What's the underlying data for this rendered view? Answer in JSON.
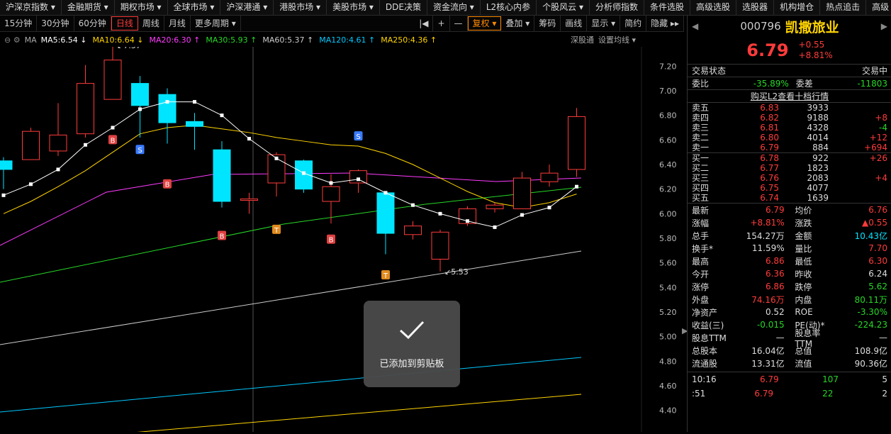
{
  "nav": [
    "沪深京指数 ▾",
    "金融期货 ▾",
    "期权市场 ▾",
    "全球市场 ▾",
    "沪深港通 ▾",
    "港股市场 ▾",
    "美股市场 ▾",
    "DDE决策",
    "资金流向 ▾",
    "L2核心内参",
    "个股风云 ▾",
    "分析师指数",
    "条件选股",
    "高级选股",
    "选股器",
    "机构增仓",
    "热点追击",
    "高级"
  ],
  "toolbar": {
    "periods": [
      "15分钟",
      "30分钟",
      "60分钟"
    ],
    "daily": "日线",
    "weekly": "周线",
    "monthly": "月线",
    "more": "更多周期 ▾",
    "prev": "|◀",
    "plus": "+",
    "minus": "—",
    "fuquan": "复权 ▾",
    "overlay": "叠加 ▾",
    "chouma": "筹码",
    "draw": "画线",
    "display": "显示 ▾",
    "simple": "简约",
    "hide": "隐藏 ▸▸",
    "collapse": "◀"
  },
  "ma": {
    "label": "MA",
    "items": [
      {
        "text": "MA5:6.54 ↓",
        "color": "#ffffff"
      },
      {
        "text": "MA10:6.64 ↓",
        "color": "#ffd400"
      },
      {
        "text": "MA20:6.30 ↑",
        "color": "#ff3bff"
      },
      {
        "text": "MA30:5.93 ↑",
        "color": "#27d727"
      },
      {
        "text": "MA60:5.37 ↑",
        "color": "#cccccc"
      },
      {
        "text": "MA120:4.61 ↑",
        "color": "#00c8ff"
      },
      {
        "text": "MA250:4.36 ↑",
        "color": "#ffd400"
      }
    ],
    "right1": "深股通",
    "right2": "设置均线 ▾"
  },
  "chart_data": {
    "type": "candlestick",
    "ylim": [
      4.3,
      7.3
    ],
    "yticks": [
      "7.20",
      "7.00",
      "6.80",
      "6.60",
      "6.40",
      "6.20",
      "6.00",
      "5.80",
      "5.60",
      "5.40",
      "5.20",
      "5.00",
      "4.80",
      "4.60",
      "4.40"
    ],
    "candles": [
      {
        "o": 6.43,
        "c": 6.36,
        "h": 6.46,
        "l": 6.2
      },
      {
        "o": 6.44,
        "c": 6.67,
        "h": 6.7,
        "l": 6.44
      },
      {
        "o": 6.51,
        "c": 6.64,
        "h": 6.9,
        "l": 6.47
      },
      {
        "o": 6.65,
        "c": 7.06,
        "h": 7.21,
        "l": 6.62
      },
      {
        "o": 6.93,
        "c": 7.25,
        "h": 7.37,
        "l": 6.93
      },
      {
        "o": 7.06,
        "c": 6.88,
        "h": 7.12,
        "l": 6.62
      },
      {
        "o": 6.97,
        "c": 6.74,
        "h": 7.02,
        "l": 6.57
      },
      {
        "o": 6.75,
        "c": 6.71,
        "h": 6.82,
        "l": 6.52
      },
      {
        "o": 6.52,
        "c": 6.1,
        "h": 6.59,
        "l": 6.05
      },
      {
        "o": 6.12,
        "c": 6.12,
        "h": 6.17,
        "l": 6.0
      },
      {
        "o": 6.25,
        "c": 6.48,
        "h": 6.5,
        "l": 6.14
      },
      {
        "o": 6.43,
        "c": 6.2,
        "h": 6.44,
        "l": 6.17
      },
      {
        "o": 6.1,
        "c": 6.22,
        "h": 6.32,
        "l": 5.92
      },
      {
        "o": 6.25,
        "c": 6.35,
        "h": 6.36,
        "l": 6.17
      },
      {
        "o": 6.17,
        "c": 5.84,
        "h": 6.18,
        "l": 5.67
      },
      {
        "o": 5.83,
        "c": 5.9,
        "h": 5.94,
        "l": 5.79
      },
      {
        "o": 5.63,
        "c": 5.85,
        "h": 5.87,
        "l": 5.53
      },
      {
        "o": 5.92,
        "c": 6.04,
        "h": 6.06,
        "l": 5.9
      },
      {
        "o": 6.04,
        "c": 6.07,
        "h": 6.09,
        "l": 6.01
      },
      {
        "o": 6.04,
        "c": 6.29,
        "h": 6.34,
        "l": 6.04
      },
      {
        "o": 6.26,
        "c": 6.33,
        "h": 6.4,
        "l": 6.22
      },
      {
        "o": 6.36,
        "c": 6.79,
        "h": 6.86,
        "l": 6.3
      }
    ],
    "ma5": [
      6.15,
      6.24,
      6.36,
      6.56,
      6.7,
      6.85,
      6.91,
      6.91,
      6.8,
      6.61,
      6.45,
      6.33,
      6.25,
      6.28,
      6.17,
      6.07,
      6.0,
      5.94,
      5.89,
      5.99,
      6.05,
      6.22
    ],
    "ma10": [
      6.0,
      6.1,
      6.22,
      6.35,
      6.5,
      6.65,
      6.7,
      6.72,
      6.69,
      6.66,
      6.62,
      6.59,
      6.56,
      6.55,
      6.49,
      6.4,
      6.29,
      6.18,
      6.09,
      6.05,
      6.09,
      6.16
    ],
    "markers": [
      {
        "i": 4,
        "t": "↙7.37",
        "p": 7.37
      },
      {
        "i": 16,
        "t": "↙5.53",
        "p": 5.53
      }
    ],
    "signals": [
      {
        "i": 4,
        "t": "B",
        "p": 6.6
      },
      {
        "i": 5,
        "t": "S",
        "p": 6.52
      },
      {
        "i": 6,
        "t": "B",
        "p": 6.24
      },
      {
        "i": 8,
        "t": "B",
        "p": 5.82
      },
      {
        "i": 10,
        "t": "T",
        "p": 5.87
      },
      {
        "i": 12,
        "t": "B",
        "p": 5.79
      },
      {
        "i": 13,
        "t": "S",
        "p": 6.63
      },
      {
        "i": 14,
        "t": "T",
        "p": 5.5
      }
    ]
  },
  "quote": {
    "code": "000796",
    "name": "凯撒旅业",
    "price": "6.79",
    "change": "+0.55",
    "pct": "+8.81%",
    "status_label": "交易状态",
    "status": "交易中",
    "webi_label": "委比",
    "webi": "-35.89%",
    "wecha_label": "委差",
    "wecha": "-11803",
    "l2": "购买L2查看十档行情",
    "asks": [
      {
        "label": "卖五",
        "price": "6.83",
        "vol": "3933",
        "chg": ""
      },
      {
        "label": "卖四",
        "price": "6.82",
        "vol": "9188",
        "chg": "+8"
      },
      {
        "label": "卖三",
        "price": "6.81",
        "vol": "4328",
        "chg": "-4"
      },
      {
        "label": "卖二",
        "price": "6.80",
        "vol": "4014",
        "chg": "+12"
      },
      {
        "label": "卖一",
        "price": "6.79",
        "vol": "884",
        "chg": "+694"
      }
    ],
    "bids": [
      {
        "label": "买一",
        "price": "6.78",
        "vol": "922",
        "chg": "+26"
      },
      {
        "label": "买二",
        "price": "6.77",
        "vol": "1823",
        "chg": ""
      },
      {
        "label": "买三",
        "price": "6.76",
        "vol": "2083",
        "chg": "+4"
      },
      {
        "label": "买四",
        "price": "6.75",
        "vol": "4077",
        "chg": ""
      },
      {
        "label": "买五",
        "price": "6.74",
        "vol": "1639",
        "chg": ""
      }
    ],
    "stats": [
      [
        "最新",
        "6.79",
        "均价",
        "6.76"
      ],
      [
        "涨幅",
        "+8.81%",
        "涨跌",
        "▲0.55"
      ],
      [
        "总手",
        "154.27万",
        "金额",
        "10.43亿"
      ],
      [
        "换手*",
        "11.59%",
        "量比",
        "7.70"
      ],
      [
        "最高",
        "6.86",
        "最低",
        "6.30"
      ],
      [
        "今开",
        "6.36",
        "昨收",
        "6.24"
      ],
      [
        "涨停",
        "6.86",
        "跌停",
        "5.62"
      ],
      [
        "外盘",
        "74.16万",
        "内盘",
        "80.11万"
      ],
      [
        "净资产",
        "0.52",
        "ROE",
        "-3.30%"
      ],
      [
        "收益(三)",
        "-0.015",
        "PE(动)*",
        "-224.23"
      ],
      [
        "股息TTM",
        "—",
        "股息率TTM",
        "—"
      ],
      [
        "总股本",
        "16.04亿",
        "总值",
        "108.9亿"
      ],
      [
        "流通股",
        "13.31亿",
        "流值",
        "90.36亿"
      ]
    ],
    "ticks": [
      {
        "time": "10:16",
        "price": "6.79",
        "vol": "107",
        "n": "5"
      },
      {
        "time": ":51",
        "price": "6.79",
        "vol": "22",
        "n": "2"
      }
    ]
  },
  "toast": {
    "text": "已添加到剪贴板"
  }
}
